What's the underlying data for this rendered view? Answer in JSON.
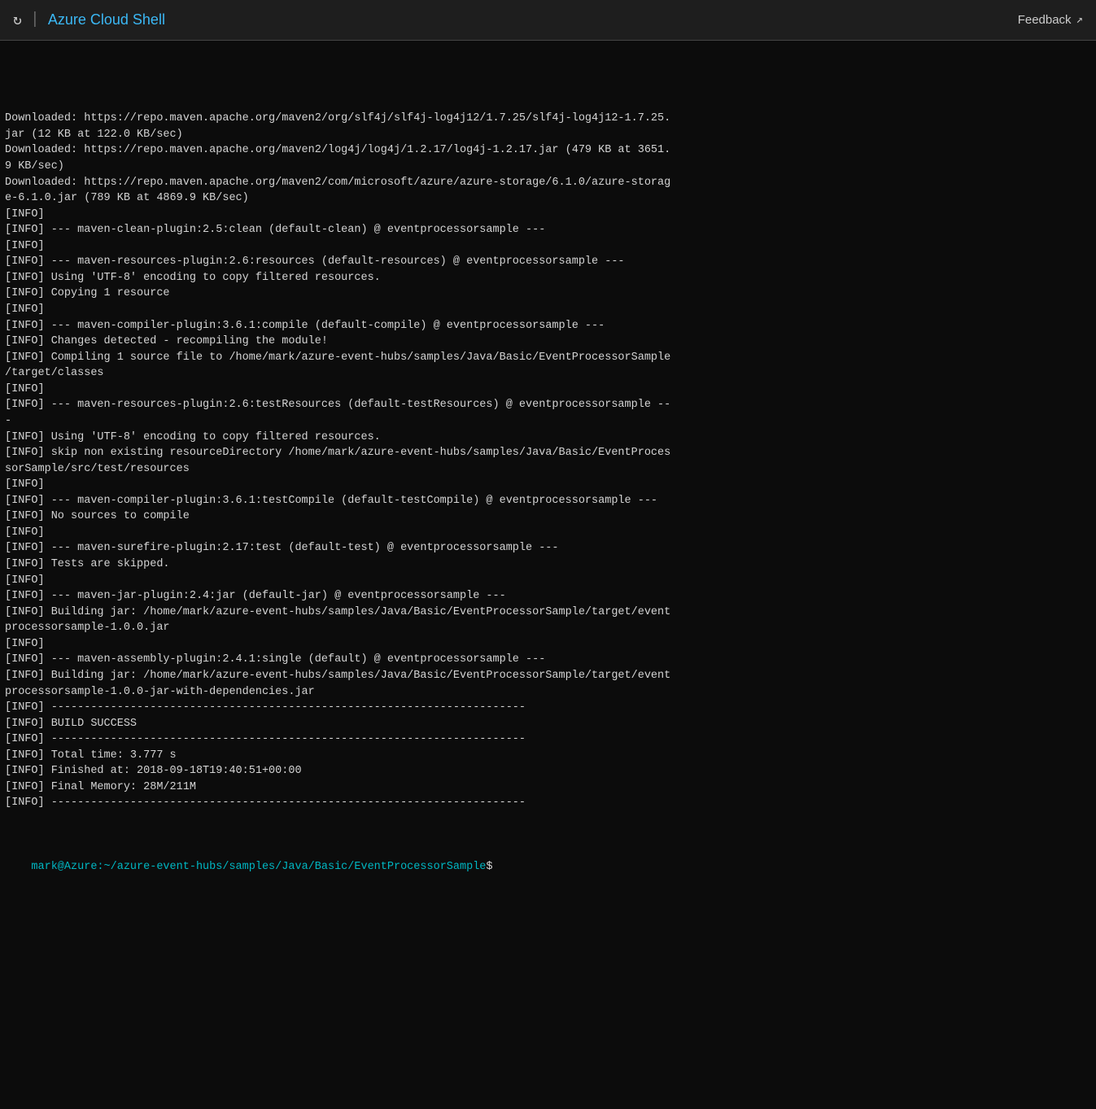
{
  "titlebar": {
    "title": "Azure Cloud Shell",
    "refresh_icon": "↻",
    "divider": "|",
    "feedback_label": "Feedback",
    "external_link_icon": "↗"
  },
  "terminal": {
    "lines": [
      "Downloaded: https://repo.maven.apache.org/maven2/org/slf4j/slf4j-log4j12/1.7.25/slf4j-log4j12-1.7.25.",
      "jar (12 KB at 122.0 KB/sec)",
      "Downloaded: https://repo.maven.apache.org/maven2/log4j/log4j/1.2.17/log4j-1.2.17.jar (479 KB at 3651.",
      "9 KB/sec)",
      "Downloaded: https://repo.maven.apache.org/maven2/com/microsoft/azure/azure-storage/6.1.0/azure-storag",
      "e-6.1.0.jar (789 KB at 4869.9 KB/sec)",
      "[INFO]",
      "[INFO] --- maven-clean-plugin:2.5:clean (default-clean) @ eventprocessorsample ---",
      "[INFO]",
      "[INFO] --- maven-resources-plugin:2.6:resources (default-resources) @ eventprocessorsample ---",
      "[INFO] Using 'UTF-8' encoding to copy filtered resources.",
      "[INFO] Copying 1 resource",
      "[INFO]",
      "[INFO] --- maven-compiler-plugin:3.6.1:compile (default-compile) @ eventprocessorsample ---",
      "[INFO] Changes detected - recompiling the module!",
      "[INFO] Compiling 1 source file to /home/mark/azure-event-hubs/samples/Java/Basic/EventProcessorSample",
      "/target/classes",
      "[INFO]",
      "[INFO] --- maven-resources-plugin:2.6:testResources (default-testResources) @ eventprocessorsample --",
      "-",
      "[INFO] Using 'UTF-8' encoding to copy filtered resources.",
      "[INFO] skip non existing resourceDirectory /home/mark/azure-event-hubs/samples/Java/Basic/EventProces",
      "sorSample/src/test/resources",
      "[INFO]",
      "[INFO] --- maven-compiler-plugin:3.6.1:testCompile (default-testCompile) @ eventprocessorsample ---",
      "[INFO] No sources to compile",
      "[INFO]",
      "[INFO] --- maven-surefire-plugin:2.17:test (default-test) @ eventprocessorsample ---",
      "[INFO] Tests are skipped.",
      "[INFO]",
      "[INFO] --- maven-jar-plugin:2.4:jar (default-jar) @ eventprocessorsample ---",
      "[INFO] Building jar: /home/mark/azure-event-hubs/samples/Java/Basic/EventProcessorSample/target/event",
      "processorsample-1.0.0.jar",
      "[INFO]",
      "[INFO] --- maven-assembly-plugin:2.4.1:single (default) @ eventprocessorsample ---",
      "[INFO] Building jar: /home/mark/azure-event-hubs/samples/Java/Basic/EventProcessorSample/target/event",
      "processorsample-1.0.0-jar-with-dependencies.jar",
      "[INFO] ------------------------------------------------------------------------",
      "[INFO] BUILD SUCCESS",
      "[INFO] ------------------------------------------------------------------------",
      "[INFO] Total time: 3.777 s",
      "[INFO] Finished at: 2018-09-18T19:40:51+00:00",
      "[INFO] Final Memory: 28M/211M",
      "[INFO] ------------------------------------------------------------------------"
    ],
    "prompt_user": "mark@Azure",
    "prompt_path": ":~/azure-event-hubs/samples/Java/Basic/EventProcessorSample",
    "prompt_symbol": "$"
  }
}
